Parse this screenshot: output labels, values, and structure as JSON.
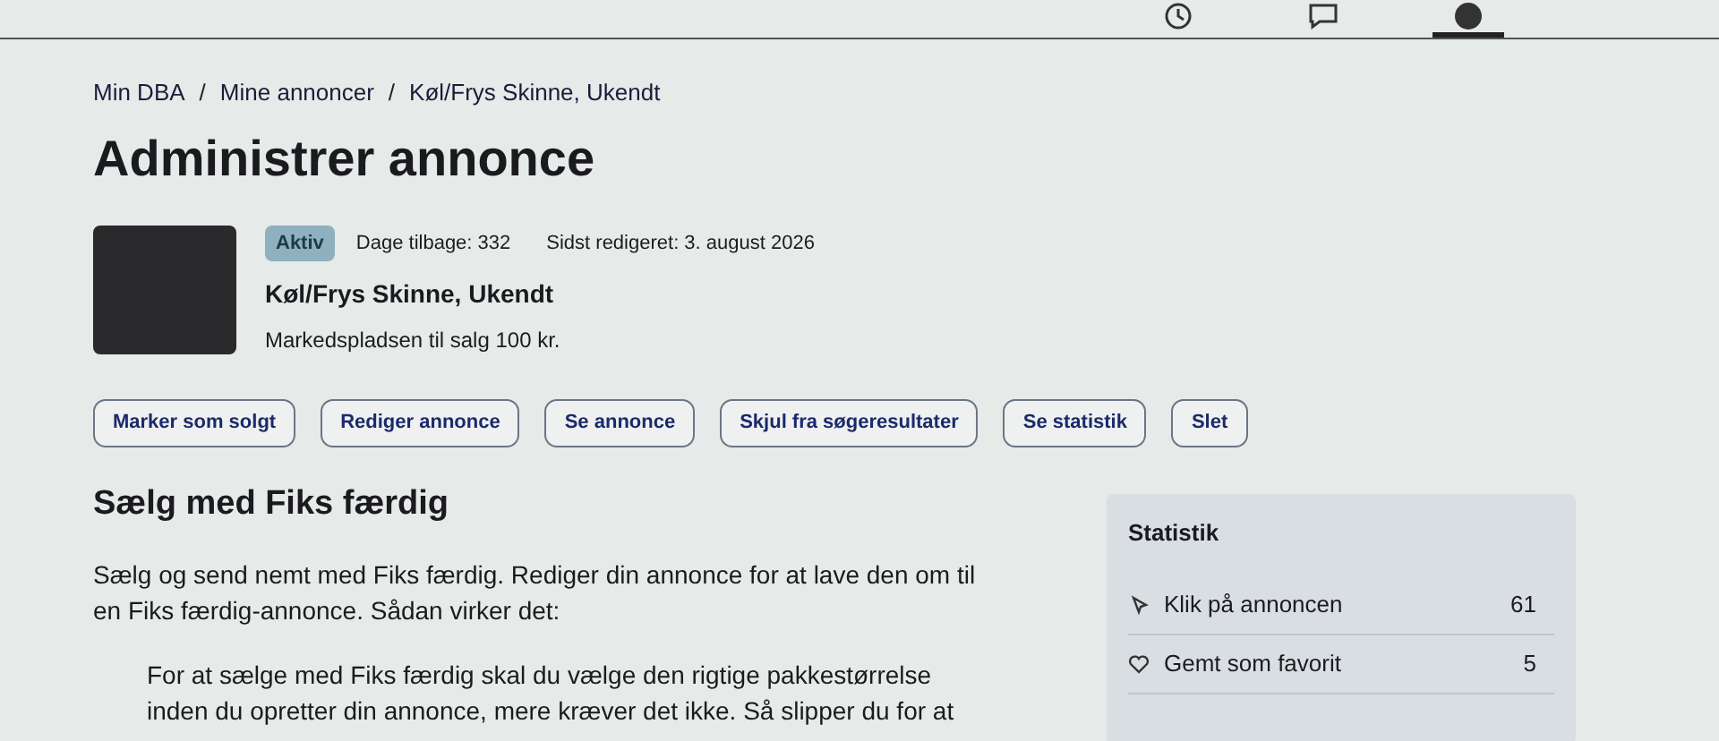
{
  "top_nav": {
    "items": [
      {
        "kind": "clock",
        "selected": false
      },
      {
        "kind": "chat",
        "selected": false
      },
      {
        "kind": "profile",
        "selected": true
      }
    ]
  },
  "breadcrumbs": [
    {
      "label": "Min DBA",
      "separator": "/"
    },
    {
      "label": "Mine annoncer",
      "separator": "/"
    },
    {
      "label": "Køl/Frys Skinne, Ukendt"
    }
  ],
  "title": "Administrer annonce",
  "listing": {
    "status": "Aktiv",
    "days_back": "Dage tilbage: 332",
    "last_edited": "Sidst redigeret: 3. august 2026",
    "name": "Køl/Frys Skinne, Ukendt",
    "category": "Markedspladsen til salg 100 kr."
  },
  "actions": [
    "Marker som solgt",
    "Rediger annonce",
    "Se annonce",
    "Skjul fra søgeresultater",
    "Se statistik",
    "Slet"
  ],
  "fiks": {
    "heading": "Sælg med Fiks færdig",
    "intro": "Sælg og send nemt med Fiks færdig. Rediger din annonce for at lave den om til en Fiks færdig-annonce. Sådan virker det:",
    "quote": "For at sælge med Fiks færdig skal du vælge den rigtige pakkestørrelse inden du opretter din annonce, mere kræver det ikke. Så slipper du for at"
  },
  "stats": {
    "title": "Statistik",
    "rows": [
      {
        "kind": "clicks",
        "label": "Klik på annoncen",
        "value": "61"
      },
      {
        "kind": "favorites",
        "label": "Gemt som favorit",
        "value": "5"
      }
    ]
  }
}
